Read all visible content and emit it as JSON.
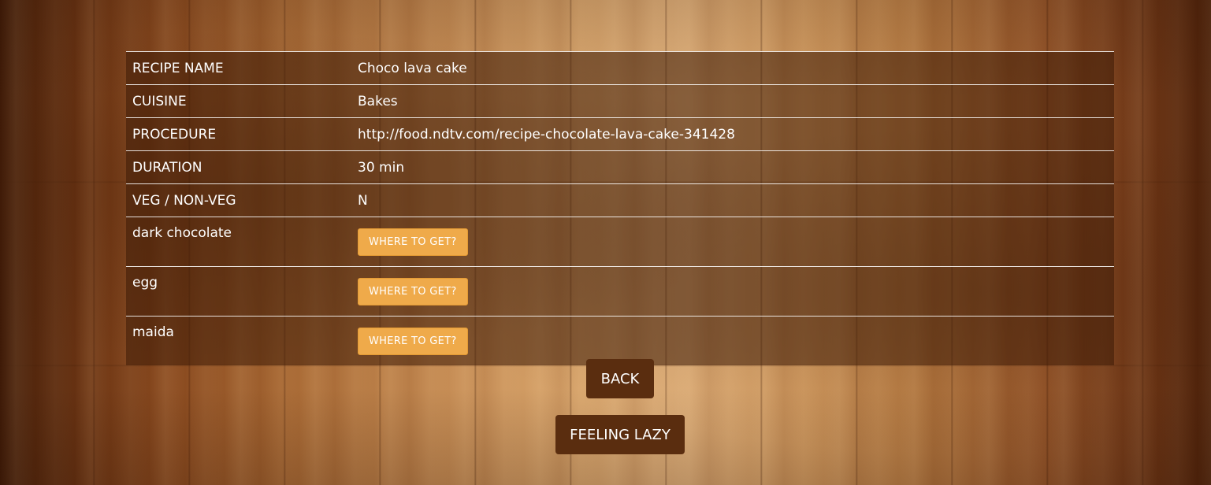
{
  "recipe": {
    "rows": [
      {
        "label": "RECIPE NAME",
        "value": "Choco lava cake"
      },
      {
        "label": "CUISINE",
        "value": "Bakes"
      },
      {
        "label": "PROCEDURE",
        "value": "http://food.ndtv.com/recipe-chocolate-lava-cake-341428"
      },
      {
        "label": "DURATION",
        "value": "30 min"
      },
      {
        "label": "VEG / NON-VEG",
        "value": "N"
      }
    ],
    "ingredients": [
      {
        "name": "dark chocolate",
        "button_label": "WHERE TO GET?"
      },
      {
        "name": "egg",
        "button_label": "WHERE TO GET?"
      },
      {
        "name": "maida",
        "button_label": "WHERE TO GET?"
      }
    ]
  },
  "actions": {
    "back_label": "BACK",
    "feeling_lazy_label": "FEELING LAZY"
  },
  "colors": {
    "where_button": "#efaa4a",
    "action_button": "#5a2d0f",
    "table_background": "rgba(60,25,5,0.55)"
  }
}
